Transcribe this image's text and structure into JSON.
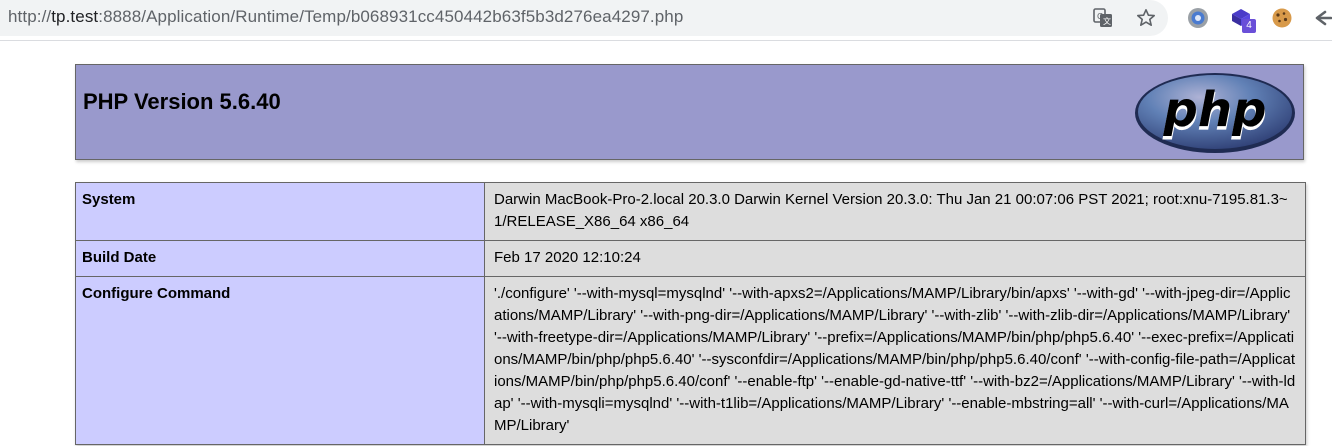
{
  "browser": {
    "url_prefix": "http://",
    "url_host": "tp.test",
    "url_rest": ":8888/Application/Runtime/Temp/b068931cc450442b63f5b3d276ea4297.php",
    "extension_badge": "4",
    "icons": [
      "translate-icon",
      "bookmark-star-icon",
      "extension-circle-icon",
      "extension-purple-icon",
      "cookie-icon",
      "extension-back-icon"
    ]
  },
  "phpinfo": {
    "version_title": "PHP Version 5.6.40",
    "logo_text": "php",
    "colors": {
      "header_bg": "#9999cc",
      "key_bg": "#ccccff",
      "value_bg": "#dddddd",
      "logo_bg": "#6181b6"
    },
    "rows": [
      {
        "key": "System",
        "value": "Darwin MacBook-Pro-2.local 20.3.0 Darwin Kernel Version 20.3.0: Thu Jan 21 00:07:06 PST 2021; root:xnu-7195.81.3~1/RELEASE_X86_64 x86_64"
      },
      {
        "key": "Build Date",
        "value": "Feb 17 2020 12:10:24"
      },
      {
        "key": "Configure Command",
        "value": "'./configure' '--with-mysql=mysqlnd' '--with-apxs2=/Applications/MAMP/Library/bin/apxs' '--with-gd' '--with-jpeg-dir=/Applications/MAMP/Library' '--with-png-dir=/Applications/MAMP/Library' '--with-zlib' '--with-zlib-dir=/Applications/MAMP/Library' '--with-freetype-dir=/Applications/MAMP/Library' '--prefix=/Applications/MAMP/bin/php/php5.6.40' '--exec-prefix=/Applications/MAMP/bin/php/php5.6.40' '--sysconfdir=/Applications/MAMP/bin/php/php5.6.40/conf' '--with-config-file-path=/Applications/MAMP/bin/php/php5.6.40/conf' '--enable-ftp' '--enable-gd-native-ttf' '--with-bz2=/Applications/MAMP/Library' '--with-ldap' '--with-mysqli=mysqlnd' '--with-t1lib=/Applications/MAMP/Library' '--enable-mbstring=all' '--with-curl=/Applications/MAMP/Library'"
      }
    ]
  }
}
